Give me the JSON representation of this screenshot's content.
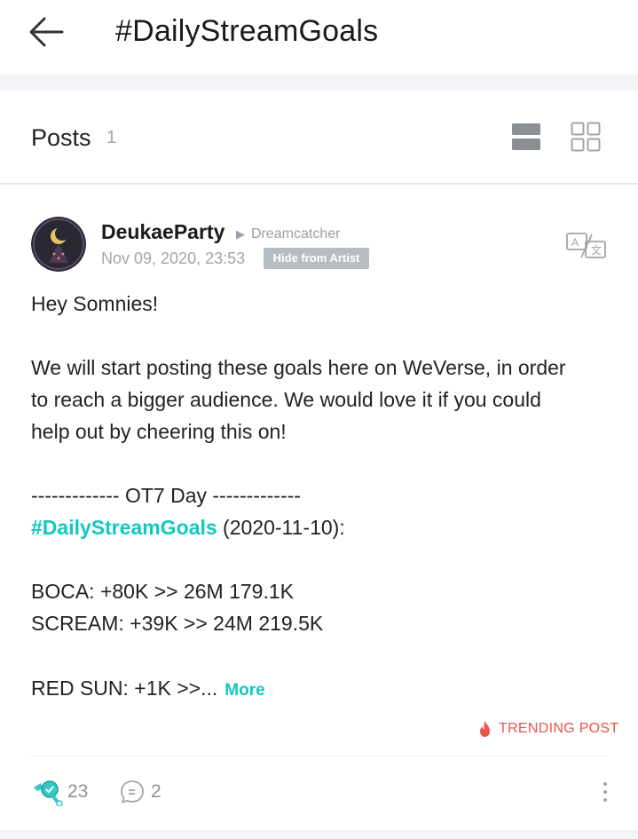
{
  "header": {
    "title": "#DailyStreamGoals"
  },
  "posts_section": {
    "label": "Posts",
    "count": "1"
  },
  "post": {
    "author": "DeukaeParty",
    "community": "Dreamcatcher",
    "date": "Nov 09, 2020, 23:53",
    "hide_label": "Hide from Artist",
    "lines": {
      "greeting": "Hey Somnies!",
      "p1": "We will start posting these goals here on WeVerse, in order",
      "p2": "to reach a bigger audience. We would love it if you could",
      "p3": "help out by cheering this on!",
      "divider_line": "------------- OT7 Day -------------",
      "hashtag": "#DailyStreamGoals",
      "hashtag_suffix": " (2020-11-10):",
      "boca": "BOCA: +80K >> 26M 179.1K",
      "scream": "SCREAM: +39K >> 24M 219.5K",
      "red_sun": "RED SUN: +1K >>..."
    },
    "more_label": "More",
    "trending_label": "TRENDING POST",
    "likes": "23",
    "comments": "2"
  },
  "colors": {
    "accent": "#10c8c0",
    "trending": "#e8534b",
    "muted": "#a0a4ab",
    "badge": "#b7bcc3"
  },
  "icons": {
    "back": "back-arrow-icon",
    "list_view": "list-view-icon",
    "grid_view": "grid-view-icon",
    "translate": "translate-icon",
    "flame": "flame-icon",
    "like": "cheer-like-icon",
    "comment": "comment-icon",
    "more": "more-vertical-icon"
  }
}
